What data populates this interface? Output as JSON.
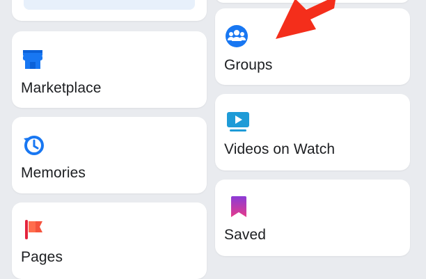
{
  "shortcuts": {
    "left": [
      {
        "label": "Marketplace",
        "icon": "marketplace-icon"
      },
      {
        "label": "Memories",
        "icon": "memories-icon"
      },
      {
        "label": "Pages",
        "icon": "pages-icon"
      }
    ],
    "right": [
      {
        "label": "Groups",
        "icon": "groups-icon"
      },
      {
        "label": "Videos on Watch",
        "icon": "video-icon"
      },
      {
        "label": "Saved",
        "icon": "saved-icon"
      }
    ]
  },
  "colors": {
    "background": "#e9ebef",
    "card": "#ffffff",
    "blue": "#1877f2",
    "annotation_arrow": "#f42e1b"
  }
}
